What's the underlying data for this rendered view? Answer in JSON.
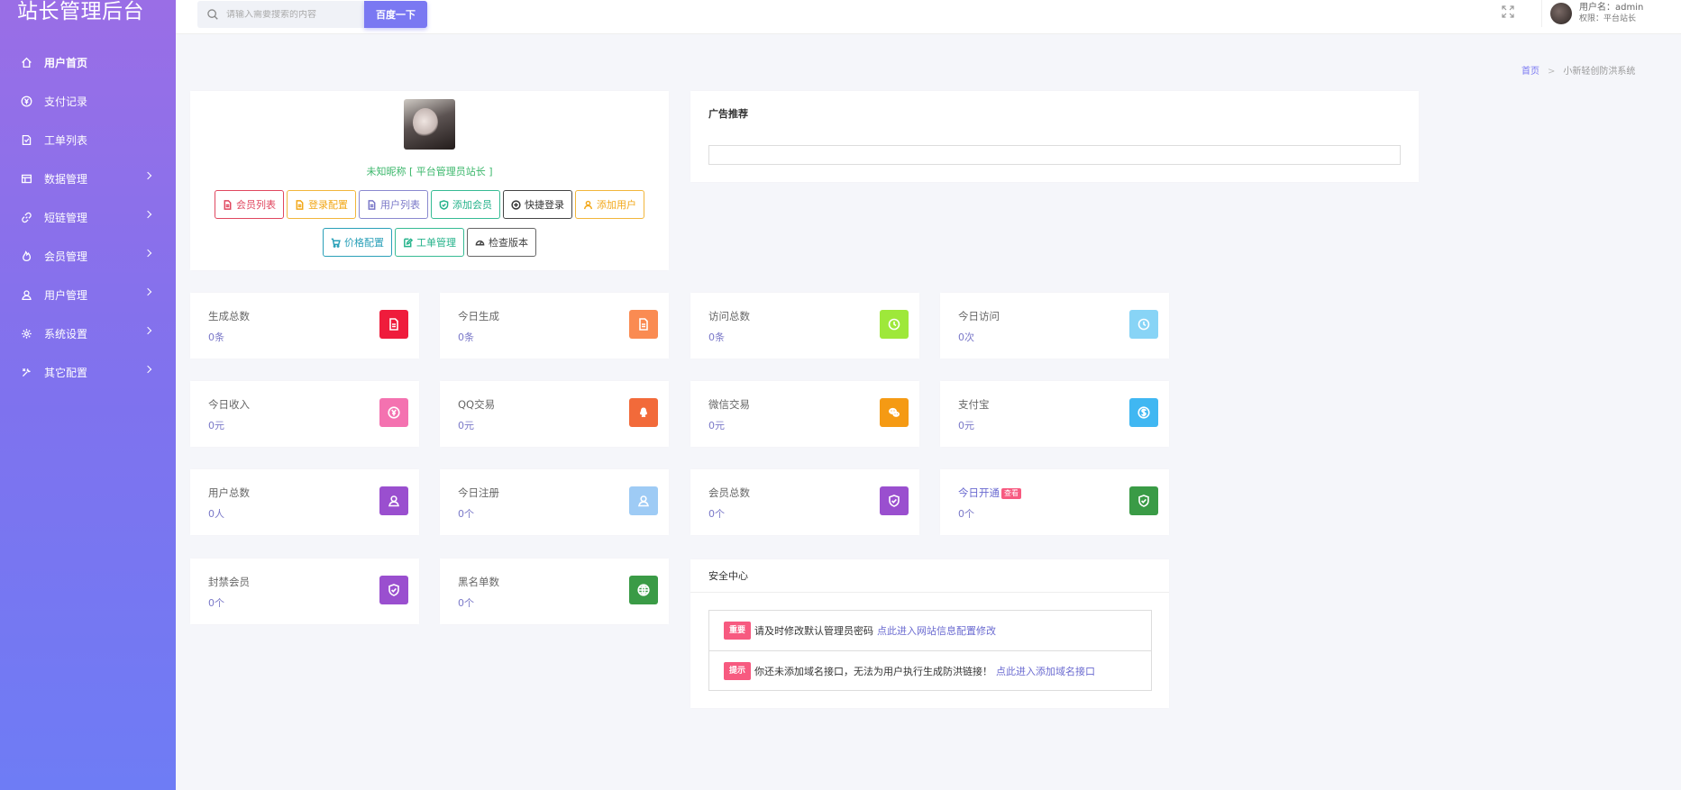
{
  "app": {
    "title": "站长管理后台"
  },
  "sidebar": {
    "items": [
      {
        "label": "用户首页",
        "icon": "home-icon",
        "active": true,
        "has_arrow": false
      },
      {
        "label": "支付记录",
        "icon": "yen-icon",
        "active": false,
        "has_arrow": false
      },
      {
        "label": "工单列表",
        "icon": "ticket-icon",
        "active": false,
        "has_arrow": false
      },
      {
        "label": "数据管理",
        "icon": "database-icon",
        "active": false,
        "has_arrow": true
      },
      {
        "label": "短链管理",
        "icon": "link-icon",
        "active": false,
        "has_arrow": true
      },
      {
        "label": "会员管理",
        "icon": "fire-icon",
        "active": false,
        "has_arrow": true
      },
      {
        "label": "用户管理",
        "icon": "user-icon",
        "active": false,
        "has_arrow": true
      },
      {
        "label": "系统设置",
        "icon": "gear-icon",
        "active": false,
        "has_arrow": true
      },
      {
        "label": "其它配置",
        "icon": "tools-icon",
        "active": false,
        "has_arrow": true
      }
    ]
  },
  "header": {
    "search_placeholder": "请输入需要搜索的内容",
    "search_button": "百度一下",
    "username": "用户名：admin",
    "role": "权限：平台站长"
  },
  "breadcrumb": {
    "home": "首页",
    "current": "小新轻创防洪系统"
  },
  "profile": {
    "nickname": "未知昵称 [ 平台管理员站长 ]",
    "buttons_row1": [
      {
        "label": "会员列表",
        "color": "#e0475f",
        "icon": "document-icon"
      },
      {
        "label": "登录配置",
        "color": "#f2a81a",
        "icon": "document-icon"
      },
      {
        "label": "用户列表",
        "color": "#7a78c8",
        "icon": "document-icon"
      },
      {
        "label": "添加会员",
        "color": "#23b28a",
        "icon": "shield-check-icon"
      },
      {
        "label": "快捷登录",
        "color": "#333333",
        "icon": "plus-circle-icon"
      },
      {
        "label": "添加用户",
        "color": "#f2a81a",
        "icon": "user-icon"
      }
    ],
    "buttons_row2": [
      {
        "label": "价格配置",
        "color": "#2aa0b8",
        "icon": "cart-icon"
      },
      {
        "label": "工单管理",
        "color": "#23b28a",
        "icon": "edit-icon"
      },
      {
        "label": "检查版本",
        "color": "#444444",
        "icon": "gauge-icon"
      }
    ]
  },
  "ad": {
    "title": "广告推荐"
  },
  "stats": [
    {
      "label": "生成总数",
      "value": "0条",
      "color": "#ef1c3c",
      "icon": "document-icon"
    },
    {
      "label": "今日生成",
      "value": "0条",
      "color": "#fa8b52",
      "icon": "document-icon"
    },
    {
      "label": "访问总数",
      "value": "0条",
      "color": "#9ee83a",
      "icon": "clock-icon"
    },
    {
      "label": "今日访问",
      "value": "0次",
      "color": "#88d4f6",
      "icon": "clock-icon"
    },
    {
      "label": "今日收入",
      "value": "0元",
      "color": "#f472b0",
      "icon": "yen-icon"
    },
    {
      "label": "QQ交易",
      "value": "0元",
      "color": "#f26a3a",
      "icon": "qq-icon"
    },
    {
      "label": "微信交易",
      "value": "0元",
      "color": "#f59a14",
      "icon": "wechat-icon"
    },
    {
      "label": "支付宝",
      "value": "0元",
      "color": "#40b7f2",
      "icon": "dollar-icon"
    },
    {
      "label": "用户总数",
      "value": "0人",
      "color": "#9a4fcf",
      "icon": "user-icon"
    },
    {
      "label": "今日注册",
      "value": "0个",
      "color": "#9ecbf5",
      "icon": "user-icon"
    },
    {
      "label": "会员总数",
      "value": "0个",
      "color": "#9a4fcf",
      "icon": "shield-check-icon"
    },
    {
      "label": "今日开通",
      "value": "0个",
      "color": "#3a9b46",
      "icon": "shield-check-icon",
      "badge": "查看"
    },
    {
      "label": "封禁会员",
      "value": "0个",
      "color": "#9a4fcf",
      "icon": "shield-check-icon"
    },
    {
      "label": "黑名单数",
      "value": "0个",
      "color": "#3a9b46",
      "icon": "globe-icon"
    }
  ],
  "security": {
    "title": "安全中心",
    "items": [
      {
        "tag": "重要",
        "text": "请及时修改默认管理员密码",
        "link": "点此进入网站信息配置修改"
      },
      {
        "tag": "提示",
        "text": "你还未添加域名接口，无法为用户执行生成防洪链接！",
        "link": "点此进入添加域名接口"
      }
    ]
  }
}
